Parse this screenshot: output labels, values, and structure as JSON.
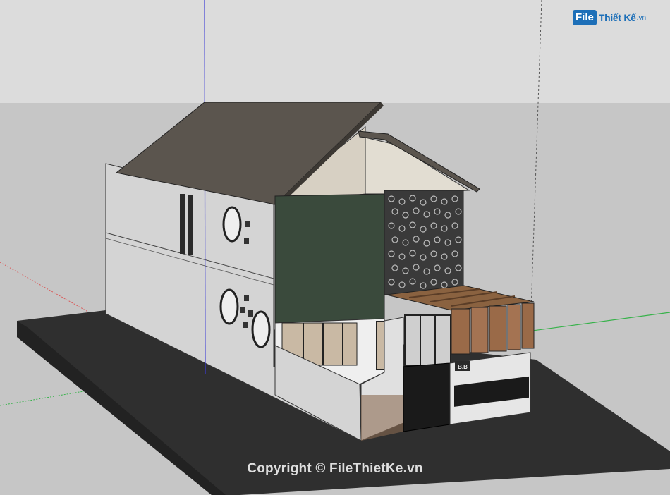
{
  "logo": {
    "badge": "File",
    "name": "Thiết Kế",
    "suffix": ".vn"
  },
  "watermark": "Copyright © FileThietKe.vn",
  "house_sign": "B.B",
  "colors": {
    "sky": "#dcdcdc",
    "ground": "#c8c8c8",
    "base": "#2f2f2f",
    "roof": "#5b554e",
    "wall": "#d4d4d4",
    "green_panel": "#3a4a3c",
    "wood": "#9a6a48",
    "axis_blue": "#3b3bd6",
    "axis_green": "#37b24a",
    "axis_red": "#d95c5c"
  }
}
